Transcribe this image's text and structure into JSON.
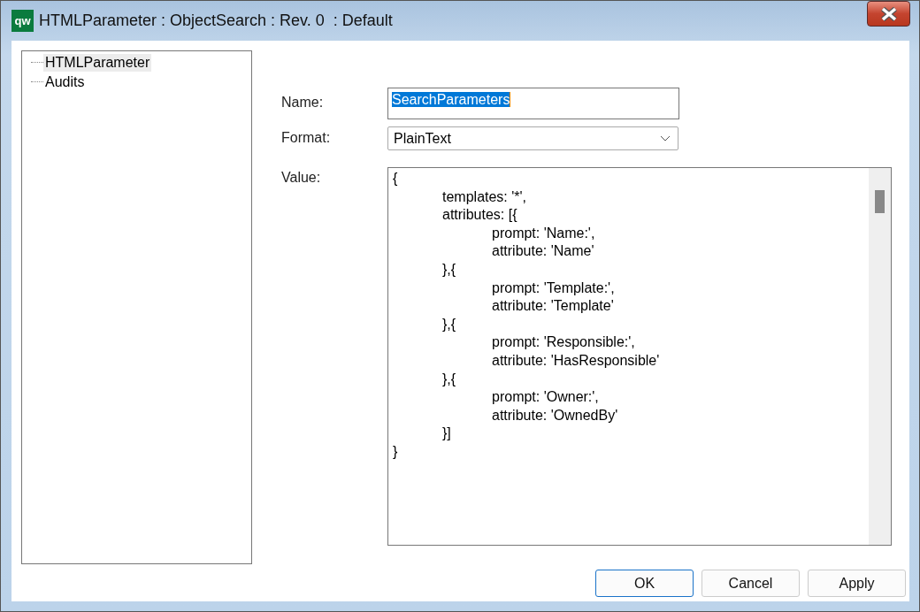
{
  "window": {
    "logo": "qw",
    "title": "HTMLParameter : ObjectSearch : Rev. 0  : Default"
  },
  "tree": {
    "items": [
      {
        "label": "HTMLParameter",
        "selected": true
      },
      {
        "label": "Audits",
        "selected": false
      }
    ]
  },
  "form": {
    "name": {
      "label": "Name:",
      "value": "SearchParameters"
    },
    "format": {
      "label": "Format:",
      "value": "PlainText"
    },
    "value": {
      "label": "Value:",
      "lines": [
        "{",
        "\ttemplates: '*',",
        "\tattributes: [{",
        "\t\tprompt: 'Name:',",
        "\t\tattribute: 'Name'",
        "\t},{",
        "\t\tprompt: 'Template:',",
        "\t\tattribute: 'Template'",
        "\t},{",
        "\t\tprompt: 'Responsible:',",
        "\t\tattribute: 'HasResponsible'",
        "\t},{",
        "\t\tprompt: 'Owner:',",
        "\t\tattribute: 'OwnedBy'",
        "\t}]",
        "}"
      ]
    }
  },
  "buttons": [
    {
      "label": "OK",
      "default": true
    },
    {
      "label": "Cancel",
      "default": false
    },
    {
      "label": "Apply",
      "default": false
    }
  ]
}
